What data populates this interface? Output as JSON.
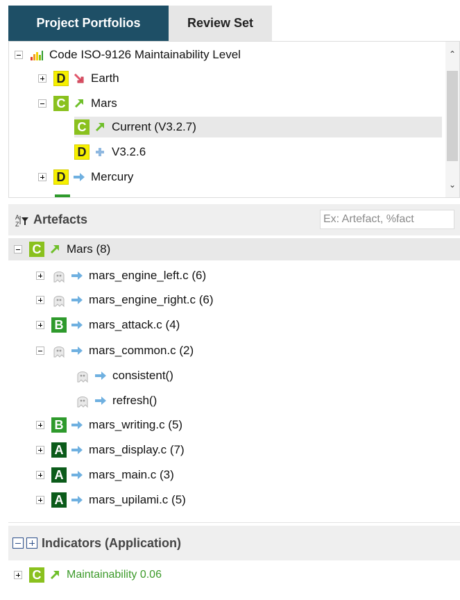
{
  "tabs": {
    "active": "Project Portfolios",
    "inactive": "Review Set"
  },
  "portfolio": {
    "root": "Code ISO-9126 Maintainability Level",
    "earth": {
      "grade": "D",
      "label": "Earth"
    },
    "mars": {
      "grade": "C",
      "label": "Mars"
    },
    "current": {
      "grade": "C",
      "label": "Current (V3.2.7)"
    },
    "v326": {
      "grade": "D",
      "label": "V3.2.6"
    },
    "mercury": {
      "grade": "D",
      "label": "Mercury"
    }
  },
  "artefacts": {
    "title": "Artefacts",
    "search_placeholder": "Ex: Artefact, %fact",
    "root": {
      "grade": "C",
      "label": "Mars (8)"
    },
    "items": [
      {
        "label": "mars_engine_left.c (6)",
        "grade": ""
      },
      {
        "label": "mars_engine_right.c (6)",
        "grade": ""
      },
      {
        "label": "mars_attack.c (4)",
        "grade": "B"
      },
      {
        "label": "mars_common.c (2)",
        "grade": ""
      },
      {
        "label": "consistent()",
        "grade": ""
      },
      {
        "label": "refresh()",
        "grade": ""
      },
      {
        "label": "mars_writing.c (5)",
        "grade": "B"
      },
      {
        "label": "mars_display.c (7)",
        "grade": "A"
      },
      {
        "label": "mars_main.c (3)",
        "grade": "A"
      },
      {
        "label": "mars_upilami.c (5)",
        "grade": "A"
      }
    ]
  },
  "indicators": {
    "title": "Indicators (Application)",
    "item": {
      "grade": "C",
      "label": "Maintainability 0.06"
    }
  },
  "icons": {
    "trend_up": "trend-up-arrow-icon",
    "trend_down": "trend-down-arrow-icon",
    "stable": "stable-arrow-icon",
    "new": "new-plus-icon",
    "ghost": "no-grade-ghost-icon",
    "chart": "bar-chart-icon",
    "sort_filter": "sort-filter-icon"
  },
  "colors": {
    "tab_active": "#1e4f66",
    "grade_A": "#0b5b1a",
    "grade_B": "#2e9a2c",
    "grade_C": "#8ac11e",
    "grade_D": "#f6f000",
    "indicator_text": "#3c9a2a"
  }
}
